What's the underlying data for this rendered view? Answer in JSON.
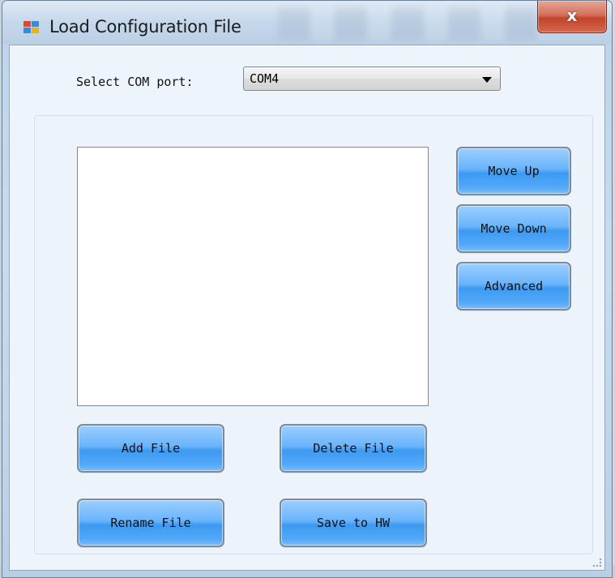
{
  "window": {
    "title": "Load Configuration File",
    "close_glyph": "x",
    "icon": "app-window-icon",
    "colors": {
      "button_blue": "#52a8f8",
      "close_red": "#c2432b",
      "client_bg": "#eef4fb"
    }
  },
  "com_port": {
    "label": "Select COM port:",
    "selected": "COM4"
  },
  "file_list": {
    "items": []
  },
  "side_buttons": {
    "move_up": "Move Up",
    "move_down": "Move Down",
    "advanced": "Advanced"
  },
  "bottom_buttons": {
    "add_file": "Add File",
    "delete_file": "Delete File",
    "rename_file": "Rename File",
    "save_to_hw": "Save to HW"
  }
}
